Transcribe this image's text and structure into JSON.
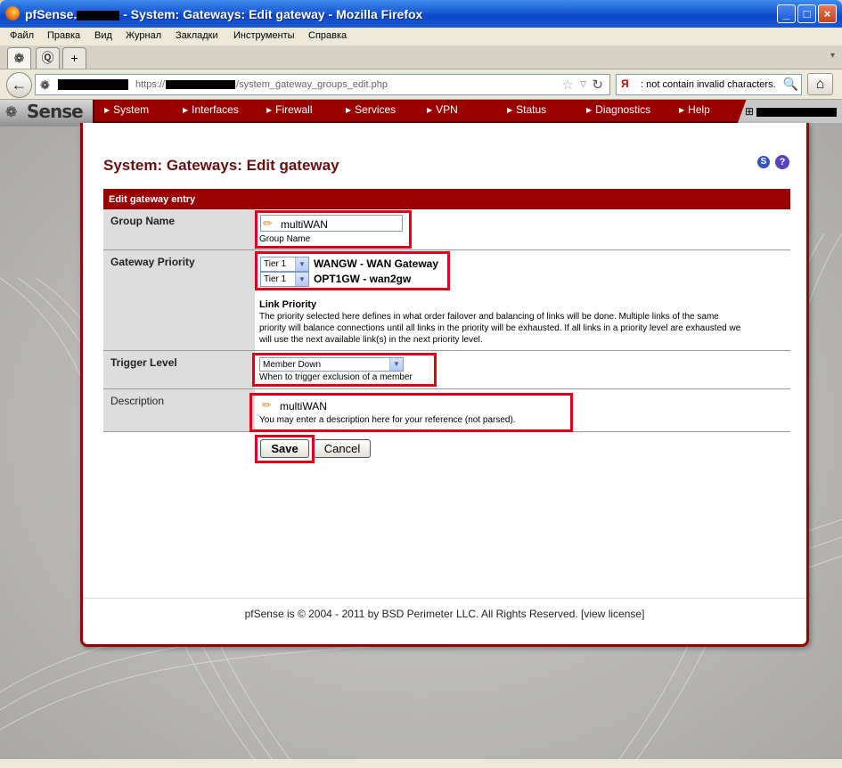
{
  "window": {
    "title_prefix": "pfSense.",
    "title_rest": " - System: Gateways: Edit gateway - Mozilla Firefox",
    "min": "_",
    "max": "□",
    "close": "×"
  },
  "menu": [
    "Файл",
    "Правка",
    "Вид",
    "Журнал",
    "Закладки",
    "Инструменты",
    "Справка"
  ],
  "tabs": {
    "new_tab": "+"
  },
  "nav": {
    "url_prefix": "https://",
    "url_suffix": "/system_gateway_groups_edit.php",
    "search_text": ": not contain invalid characters.",
    "search_engine": "Я"
  },
  "pfsense": {
    "logo": "Sense",
    "menu": [
      "System",
      "Interfaces",
      "Firewall",
      "Services",
      "VPN",
      "Status",
      "Diagnostics",
      "Help"
    ]
  },
  "page": {
    "title": "System: Gateways: Edit gateway",
    "help_s": "S",
    "help_q": "?"
  },
  "form": {
    "header": "Edit gateway entry",
    "group_name": {
      "label": "Group Name",
      "value": "multiWAN",
      "hint": "Group Name"
    },
    "gateway_priority": {
      "label": "Gateway Priority",
      "gateways": [
        {
          "tier": "Tier 1",
          "name": "WANGW - WAN Gateway"
        },
        {
          "tier": "Tier 1",
          "name": "OPT1GW - wan2gw"
        }
      ],
      "link_priority_title": "Link Priority",
      "link_priority_text_1": "The priority selected here defines in what order failover and balancing of links will be done. Multiple links of the same",
      "link_priority_text_2": "priority will balance connections until all links in the priority will be exhausted. If all links in a priority level are exhausted we",
      "link_priority_text_3": "will use the next available link(s) in the next priority level."
    },
    "trigger_level": {
      "label": "Trigger Level",
      "value": "Member Down",
      "hint": "When to trigger exclusion of a member"
    },
    "description": {
      "label": "Description",
      "value": "multiWAN",
      "hint": "You may enter a description here for your reference (not parsed)."
    },
    "save": "Save",
    "cancel": "Cancel"
  },
  "footer": "pfSense is © 2004 - 2011 by BSD Perimeter LLC. All Rights Reserved. [view license]",
  "colors": {
    "accent": "#990000",
    "annotation": "#e0001a",
    "title": "#661111"
  }
}
